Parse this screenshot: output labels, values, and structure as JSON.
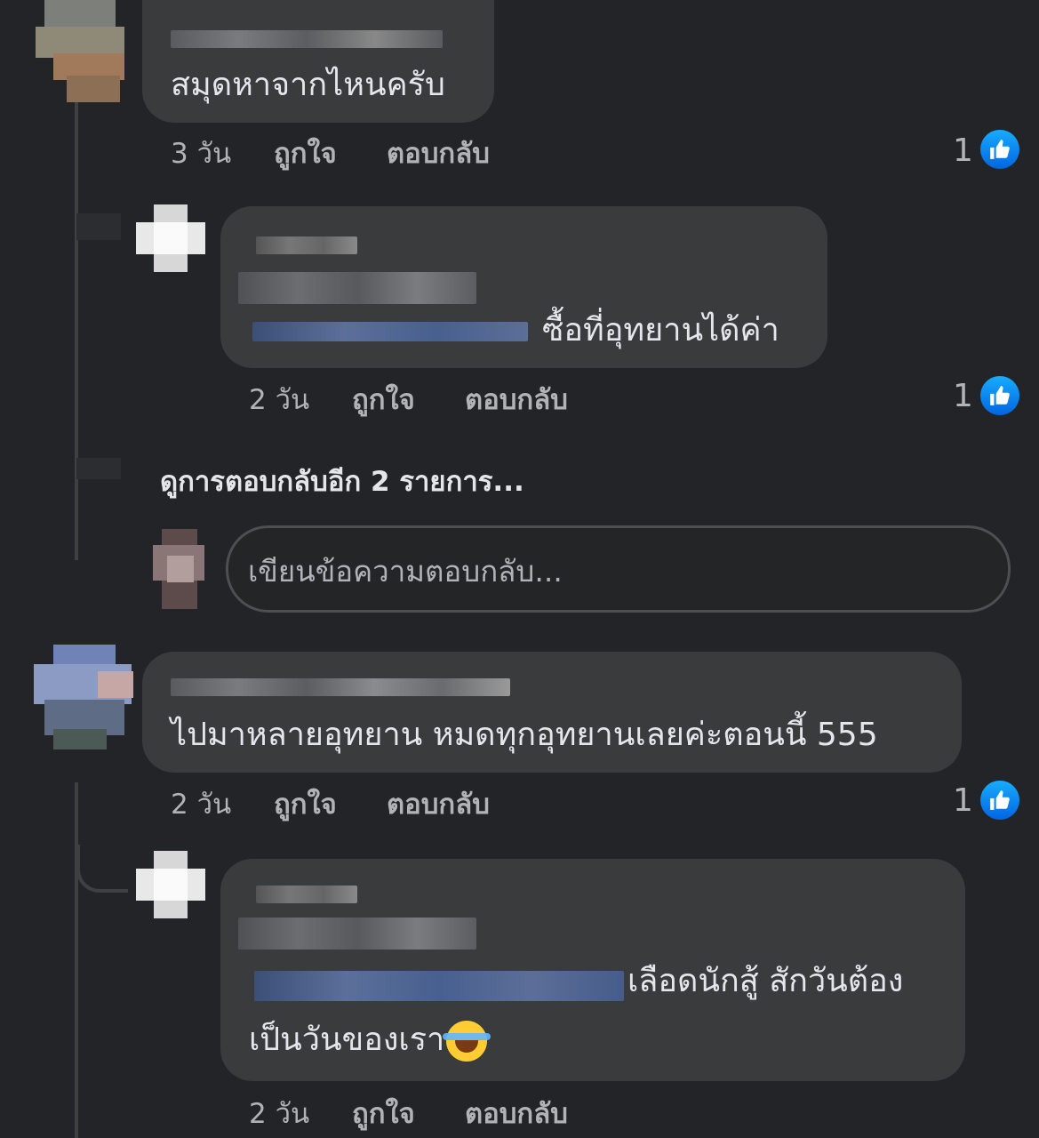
{
  "comments": [
    {
      "text": "สมุดหาจากไหนครับ",
      "time": "3 วัน",
      "like_label": "ถูกใจ",
      "reply_label": "ตอบกลับ",
      "reaction_count": "1",
      "reaction_icon": "like-icon",
      "replies": [
        {
          "text": "ซื้อที่อุทยานได้ค่า",
          "time": "2 วัน",
          "like_label": "ถูกใจ",
          "reply_label": "ตอบกลับ",
          "reaction_count": "1",
          "reaction_icon": "like-icon"
        }
      ],
      "view_more_replies": "ดูการตอบกลับอีก 2 รายการ...",
      "reply_input_placeholder": "เขียนข้อความตอบกลับ..."
    },
    {
      "text": "ไปมาหลายอุทยาน หมดทุกอุทยานเลยค่ะตอนนี้ 555",
      "time": "2 วัน",
      "like_label": "ถูกใจ",
      "reply_label": "ตอบกลับ",
      "reaction_count": "1",
      "reaction_icon": "like-icon",
      "replies": [
        {
          "text_line1": "เลือดนักสู้  สักวันต้อง",
          "text_line2": "เป็นวันของเรา",
          "emoji": "face-with-tears-of-joy",
          "time": "2 วัน",
          "like_label": "ถูกใจ",
          "reply_label": "ตอบกลับ"
        }
      ]
    }
  ],
  "colors": {
    "background": "#232427",
    "bubble": "#3a3b3c",
    "like_blue": "#1877f2",
    "meta_text": "#b0b3b8"
  }
}
